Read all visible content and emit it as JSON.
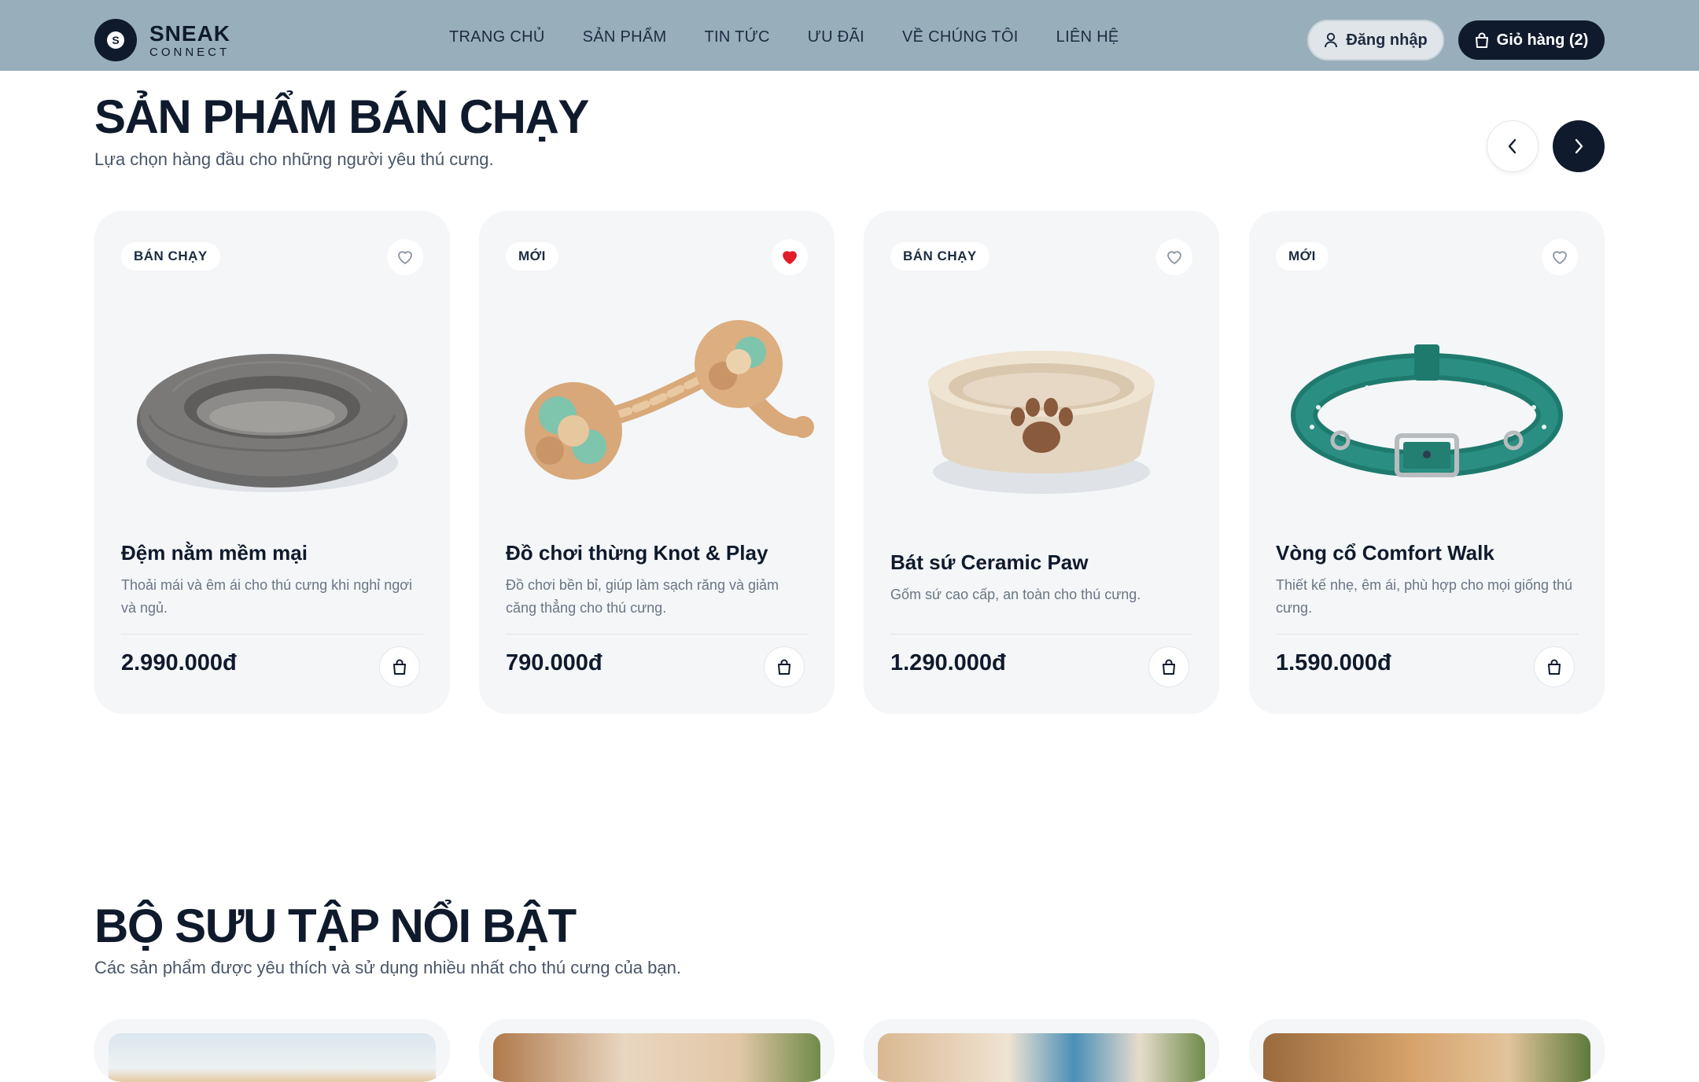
{
  "brand": {
    "name": "SNEAK",
    "sub": "CONNECT",
    "mark": "S"
  },
  "nav": {
    "items": [
      {
        "label": "TRANG CHỦ"
      },
      {
        "label": "SẢN PHẨM"
      },
      {
        "label": "TIN TỨC"
      },
      {
        "label": "ƯU ĐÃI"
      },
      {
        "label": "VỀ CHÚNG TÔI"
      },
      {
        "label": "LIÊN HỆ"
      }
    ],
    "login_label": "Đăng nhập",
    "cart_label": "Giỏ hàng (2)"
  },
  "bestsellers": {
    "title": "SẢN PHẨM BÁN CHẠY",
    "subtitle": "Lựa chọn hàng đầu cho những người yêu thú cưng.",
    "products": [
      {
        "badge": "BÁN CHẠY",
        "name": "Đệm nằm mềm mại",
        "desc": "Thoải mái và êm ái cho thú cưng khi nghỉ ngơi và ngủ.",
        "price": "2.990.000đ",
        "favorited": false,
        "image": "donut-bed"
      },
      {
        "badge": "MỚI",
        "name": "Đồ chơi thừng Knot & Play",
        "desc": "Đồ chơi bền bỉ, giúp làm sạch răng và giảm căng thẳng cho thú cưng.",
        "price": "790.000đ",
        "favorited": true,
        "image": "rope-toy"
      },
      {
        "badge": "BÁN CHẠY",
        "name": "Bát sứ Ceramic Paw",
        "desc": "Gốm sứ cao cấp, an toàn cho thú cưng.",
        "price": "1.290.000đ",
        "favorited": false,
        "image": "ceramic-bowl"
      },
      {
        "badge": "MỚI",
        "name": "Vòng cổ Comfort Walk",
        "desc": "Thiết kế nhẹ, êm ái, phù hợp cho mọi giống thú cưng.",
        "price": "1.590.000đ",
        "favorited": false,
        "image": "collar"
      }
    ]
  },
  "collection": {
    "title": "BỘ SƯU TẬP NỔI BẬT",
    "subtitle": "Các sản phẩm được yêu thích và sử dụng nhiều nhất cho thú cưng của bạn."
  },
  "colors": {
    "navy": "#0f1a2c",
    "nav_bg": "#98aebb",
    "card_bg": "#f4f6f8",
    "heart": "#e11d2a"
  }
}
